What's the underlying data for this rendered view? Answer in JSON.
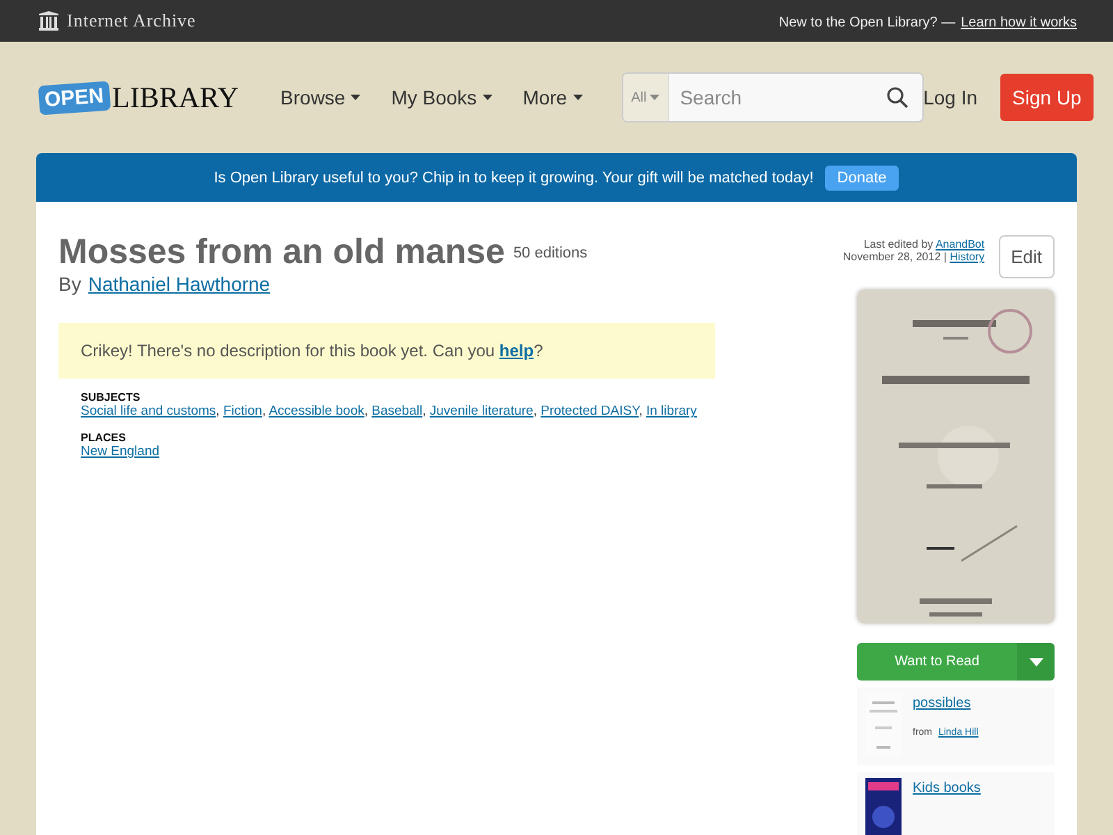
{
  "topbar": {
    "brand": "Internet Archive",
    "prompt": "New to the Open Library? —",
    "prompt_link": "Learn how it works"
  },
  "header": {
    "logo_badge": "OPEN",
    "logo_text": "LIBRARY",
    "nav": [
      {
        "label": "Browse"
      },
      {
        "label": "My Books"
      },
      {
        "label": "More"
      }
    ],
    "search": {
      "scope": "All",
      "placeholder": "Search"
    },
    "login": "Log In",
    "signup": "Sign Up"
  },
  "banner": {
    "text": "Is Open Library useful to you? Chip in to keep it growing. Your gift will be matched today!",
    "button": "Donate"
  },
  "book": {
    "title": "Mosses from an old manse",
    "editions": "50 editions",
    "by": "By",
    "author": "Nathaniel Hawthorne",
    "last_edited": "Last edited by",
    "editor": "AnandBot",
    "date": "November 28, 2012 |",
    "history": "History",
    "edit": "Edit",
    "notice": "Crikey! There's no description for this book yet. Can you",
    "notice_link": "help",
    "notice_end": "?",
    "separator": ",",
    "sections": [
      {
        "heading": "SUBJECTS",
        "links": [
          "Social life and customs",
          "Fiction",
          "Accessible book",
          "Baseball",
          "Juvenile literature",
          "Protected DAISY",
          "In library"
        ]
      },
      {
        "heading": "PLACES",
        "links": [
          "New England"
        ]
      }
    ]
  },
  "sidebar": {
    "want": "Want to Read",
    "lists": [
      {
        "name": "possibles",
        "from": "from",
        "owner": "Linda Hill"
      },
      {
        "name": "Kids books"
      }
    ]
  }
}
